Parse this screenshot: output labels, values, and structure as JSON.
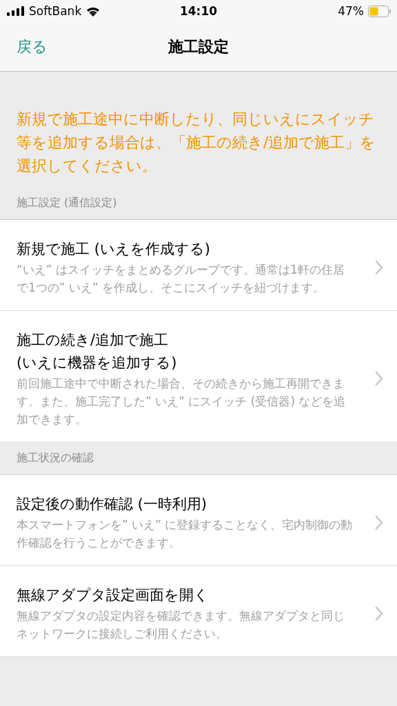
{
  "status_bar": {
    "carrier": "SoftBank",
    "time": "14:10",
    "battery": "47%"
  },
  "nav": {
    "back": "戻る",
    "title": "施工設定"
  },
  "notice": "新規で施工途中に中断したり、同じいえにスイッチ等を追加する場合は、「施工の続き/追加で施工」を選択してください。",
  "sections": [
    {
      "header": "施工設定 (通信設定)",
      "items": [
        {
          "title_lines": [
            "新規で施工 (いえを作成する)"
          ],
          "description": "“いえ” はスイッチをまとめるグループです。通常は1軒の住居で1つの” いえ” を作成し、そこにスイッチを紐づけます。"
        },
        {
          "title_lines": [
            "施工の続き/追加で施工",
            "(いえに機器を追加する)"
          ],
          "description": "前回施工途中で中断された場合、その続きから施工再開できます。また、施工完了した” いえ” にスイッチ (受信器) などを追加できます。"
        }
      ]
    },
    {
      "header": "施工状況の確認",
      "items": [
        {
          "title_lines": [
            "設定後の動作確認 (一時利用)"
          ],
          "description": "本スマートフォンを” いえ” に登録することなく、宅内制御の動作確認を行うことができます。"
        },
        {
          "title_lines": [
            "無線アダプタ設定画面を開く"
          ],
          "description": "無線アダプタの設定内容を確認できます。無線アダプタと同じネットワークに接続しご利用ください。"
        }
      ]
    }
  ]
}
